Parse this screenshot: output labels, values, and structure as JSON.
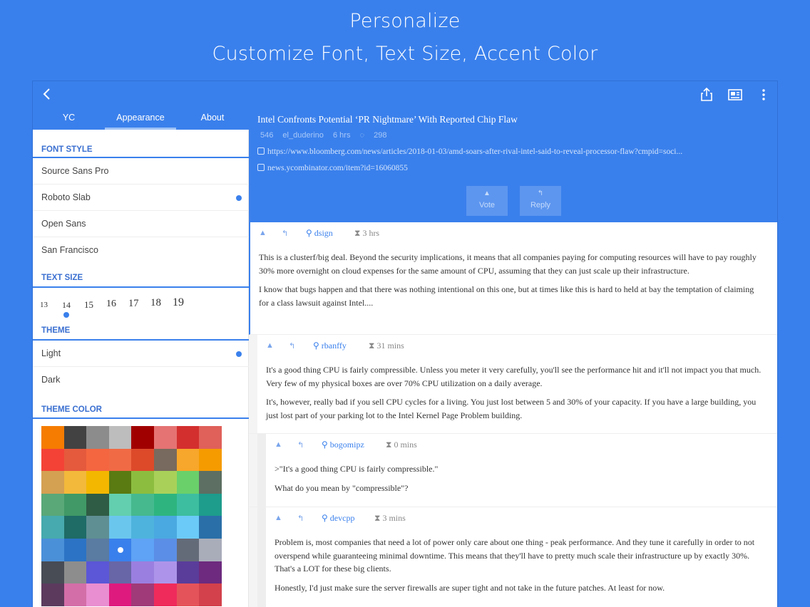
{
  "hero": {
    "title": "Personalize",
    "subtitle": "Customize Font, Text Size, Accent Color"
  },
  "toolbar": {
    "back_icon": "chevron-left-icon",
    "share_icon": "share-icon",
    "reader_icon": "reader-icon",
    "more_icon": "more-vertical-icon"
  },
  "sidebar": {
    "tabs": [
      {
        "label": "YC"
      },
      {
        "label": "Appearance"
      },
      {
        "label": "About"
      }
    ],
    "font_style": {
      "header": "FONT STYLE",
      "options": [
        "Source Sans Pro",
        "Roboto Slab",
        "Open Sans",
        "San Francisco"
      ],
      "selected": "Roboto Slab"
    },
    "text_size": {
      "header": "TEXT SIZE",
      "sizes": [
        "13",
        "14",
        "15",
        "16",
        "17",
        "18",
        "19"
      ],
      "selected": "14"
    },
    "theme": {
      "header": "THEME",
      "options": [
        "Light",
        "Dark"
      ],
      "selected": "Light"
    },
    "theme_color": {
      "header": "THEME COLOR",
      "colors": [
        [
          "#f57c00",
          "#424242",
          "#8c8c8c",
          "#bdbdbd",
          "#a10000",
          "#e57373",
          "#d32f2f",
          "#e0605a"
        ],
        [
          "#f44336",
          "#e55a3c",
          "#f4663f",
          "#f06a45",
          "#dc4a2a",
          "#786a5e",
          "#f7a72b",
          "#f59b00"
        ],
        [
          "#d4a052",
          "#f2b93b",
          "#f3b700",
          "#5a7a12",
          "#8cbd3f",
          "#a9d159",
          "#6ad06a",
          "#5c6f62"
        ],
        [
          "#5aa878",
          "#409966",
          "#2f5c44",
          "#63cfae",
          "#46b98f",
          "#2eb57f",
          "#3dbea0",
          "#1e9c8c"
        ],
        [
          "#47aaae",
          "#1f6b66",
          "#5f8f93",
          "#6bc6ee",
          "#4eb3dd",
          "#4aa9e0",
          "#6bcaf7",
          "#2a6fa8"
        ],
        [
          "#4a90d9",
          "#2c73c5",
          "#5a7ba2",
          "#3a80ec",
          "#5ea3f5",
          "#5b8ee6",
          "#646b78",
          "#a9adba"
        ],
        [
          "#474c55",
          "#8d8d8d",
          "#5b57d6",
          "#6866a6",
          "#9b7fe0",
          "#ad94ea",
          "#5a3d9a",
          "#6d2a7e"
        ],
        [
          "#5b3a5e",
          "#d46ea8",
          "#e98ed0",
          "#de1a7e",
          "#a03a78",
          "#ef2b5b",
          "#e5535a",
          "#d2414c"
        ]
      ],
      "selected_index": [
        5,
        3
      ]
    }
  },
  "story": {
    "title": "Intel Confronts Potential ‘PR Nightmare’ With Reported Chip Flaw",
    "points": "546",
    "author": "el_duderino",
    "age": "6 hrs",
    "comment_count": "298",
    "url": "https://www.bloomberg.com/news/articles/2018-01-03/amd-soars-after-rival-intel-said-to-reveal-processor-flaw?cmpid=soci...",
    "hn_url": "news.ycombinator.com/item?id=16060855",
    "vote_label": "Vote",
    "reply_label": "Reply"
  },
  "comments": [
    {
      "user": "dsign",
      "time": "3 hrs",
      "paragraphs": [
        "This is a clusterf/big deal. Beyond the security implications, it means that all companies paying for computing resources will have to pay roughly 30% more overnight on cloud expenses for the same amount of CPU, assuming that they can just scale up their infrastructure.",
        "I know that bugs happen and that there was nothing intentional on this one, but at times like this is hard to held at bay the temptation of claiming for a class lawsuit against Intel...."
      ]
    },
    {
      "user": "rbanffy",
      "time": "31 mins",
      "paragraphs": [
        "It's a good thing CPU is fairly compressible. Unless you meter it very carefully, you'll see the performance hit and it'll not impact you that much. Very few of my physical boxes are over 70% CPU utilization on a daily average.",
        "It's, however, really bad if you sell CPU cycles for a living. You just lost between 5 and 30% of your capacity. If you have a large building, you just lost part of your parking lot to the Intel Kernel Page Problem building."
      ]
    },
    {
      "user": "bogomipz",
      "time": "0 mins",
      "paragraphs": [
        ">\"It's a good thing CPU is fairly compressible.\"",
        "What do you mean by \"compressible\"?"
      ]
    },
    {
      "user": "devcpp",
      "time": "3 mins",
      "paragraphs": [
        "Problem is, most companies that need a lot of power only care about one thing - peak performance. And they tune it carefully in order to not overspend while guaranteeing minimal downtime. This means that they'll have to pretty much scale their infrastructure up by exactly 30%. That's a LOT for these big clients.",
        "Honestly, I'd just make sure the server firewalls are super tight and not take in the future patches. At least for now."
      ]
    }
  ]
}
